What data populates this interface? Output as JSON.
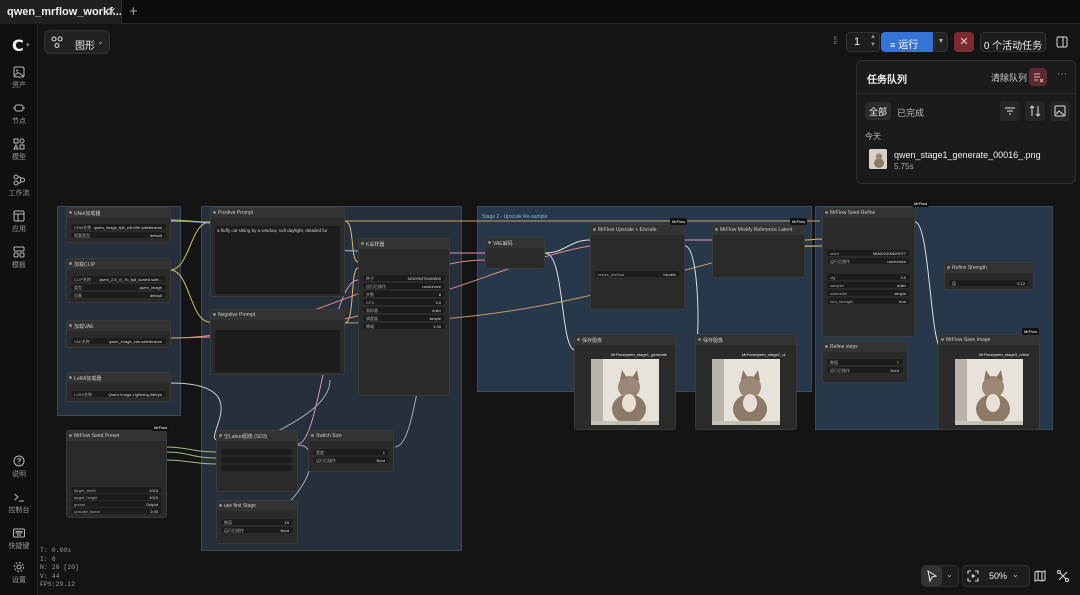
{
  "tab": {
    "title": "qwen_mrflow_workf..."
  },
  "sidebar": {
    "items": [
      {
        "label": "资产",
        "icon": "image-icon"
      },
      {
        "label": "节点",
        "icon": "node-icon"
      },
      {
        "label": "模型",
        "icon": "cube-icon"
      },
      {
        "label": "工作流",
        "icon": "workflow-icon"
      },
      {
        "label": "应用",
        "icon": "app-icon"
      },
      {
        "label": "模板",
        "icon": "template-icon"
      }
    ],
    "bottom_items": [
      {
        "label": "说明",
        "icon": "help-icon"
      },
      {
        "label": "控制台",
        "icon": "terminal-icon"
      },
      {
        "label": "快捷键",
        "icon": "keyboard-icon"
      },
      {
        "label": "设置",
        "icon": "settings-icon"
      }
    ]
  },
  "stats": {
    "t": "T: 0.00s",
    "i": "I: 0",
    "n": "N: 20 [20]",
    "v": "V: 44",
    "fps": "FPS:29.12"
  },
  "graph_menu": {
    "label": "图形"
  },
  "toolbar": {
    "quantity": "1",
    "run_label": "运行",
    "active_tasks": "0 个活动任务"
  },
  "queue": {
    "title": "任务队列",
    "clear_label": "清除队列",
    "filter_all": "全部",
    "filter_done": "已完成",
    "today_label": "今天",
    "item": {
      "filename": "qwen_stage1_generate_00016_.png",
      "duration": "5.75s"
    }
  },
  "nodes": {
    "load_diffusion": {
      "title": "UNet加载器",
      "rows": [
        [
          "UNet名称",
          "qwen_image_fp8_e4m3fn.safetensors"
        ],
        [
          "权重类型",
          "default"
        ]
      ]
    },
    "load_clip": {
      "title": "加载CLIP",
      "rows": [
        [
          "CLIP名称",
          "qwen_2.5_vl_7b_fp8_scaled.safe..."
        ],
        [
          "类型",
          "qwen_image"
        ],
        [
          "设备",
          "default"
        ]
      ]
    },
    "load_vae": {
      "title": "加载VAE",
      "rows": [
        [
          "VAE名称",
          "qwen_image_vae.safetensors"
        ]
      ]
    },
    "load_lora": {
      "title": "LoRA加载器",
      "rows": [
        [
          "LoRA名称",
          "Qwen-Image-Lightning-8steps"
        ]
      ]
    },
    "positive": {
      "title": "Positive Prompt",
      "text": "a fluffy cat sitting by a window, soft daylight, detailed fur"
    },
    "negative": {
      "title": "Negative Prompt"
    },
    "ksampler": {
      "title": "K采样器",
      "rows": [
        [
          "种子",
          "523095378400800"
        ],
        [
          "运行后操作",
          "randomize"
        ],
        [
          "步数",
          "8"
        ],
        [
          "CFG",
          "4.0"
        ],
        [
          "采样器",
          "euler"
        ],
        [
          "调度器",
          "simple"
        ],
        [
          "降噪",
          "1.00"
        ]
      ]
    },
    "vae_decode": {
      "title": "VAE解码"
    },
    "mrflow_preset": {
      "title": "MrFlow Seed Preset",
      "rows": [
        [
          "target_width",
          "1024"
        ],
        [
          "target_height",
          "1024"
        ],
        [
          "preset",
          "Output"
        ],
        [
          "upscale_factor",
          "2.00"
        ]
      ]
    },
    "empty_latent": {
      "title": "空Latent图像 (SD3)"
    },
    "switch_size": {
      "title": "Switch Size",
      "rows": [
        [
          "宽度",
          "1"
        ],
        [
          "运行后操作",
          "fixed"
        ]
      ]
    },
    "use_first_stage": {
      "title": "use first Stage",
      "rows": [
        [
          "数值",
          "10"
        ],
        [
          "运行后操作",
          "fixed"
        ]
      ]
    },
    "upscale_encode": {
      "title": "MrFlow Upscale + Encode",
      "rows": [
        [
          "resize_method",
          "bicubic"
        ]
      ]
    },
    "reference_latent": {
      "title": "MrFlow Modify Reference Latent"
    },
    "seed_refine": {
      "title": "MrFlow Seed Refine",
      "rows": [
        [
          "seed",
          "584602406623977"
        ],
        [
          "运行后操作",
          "randomize"
        ],
        [
          "cfg",
          "4.0"
        ],
        [
          "sampler",
          "euler"
        ],
        [
          "scheduler",
          "simple"
        ],
        [
          "lora_strength",
          "true"
        ]
      ]
    },
    "refine_strength": {
      "title": "Refine Strength",
      "rows": [
        [
          "值",
          "0.12"
        ]
      ]
    },
    "refine_steps": {
      "title": "Refine steps",
      "rows": [
        [
          "数值",
          "7"
        ],
        [
          "运行后操作",
          "fixed"
        ]
      ]
    },
    "preview1": {
      "title": "保存图像",
      "name": "MrFlow/qwen_stage1_generate",
      "size": "1024×1024"
    },
    "preview2": {
      "title": "保存图像",
      "name": "MrFlow/qwen_stage2_ul",
      "size": "2048×2048"
    },
    "save_image": {
      "title": "MrFlow Save Image",
      "name": "MrFlow/qwen_stage3_refine",
      "size": "2048×2048"
    },
    "group_label": "Stage 2 - Upscale Re-sample"
  },
  "badges": [
    "MrFlow",
    "MrFlow",
    "MrFlow",
    "MrFlow",
    "MrFlow"
  ],
  "zoom": {
    "level": "50%"
  }
}
